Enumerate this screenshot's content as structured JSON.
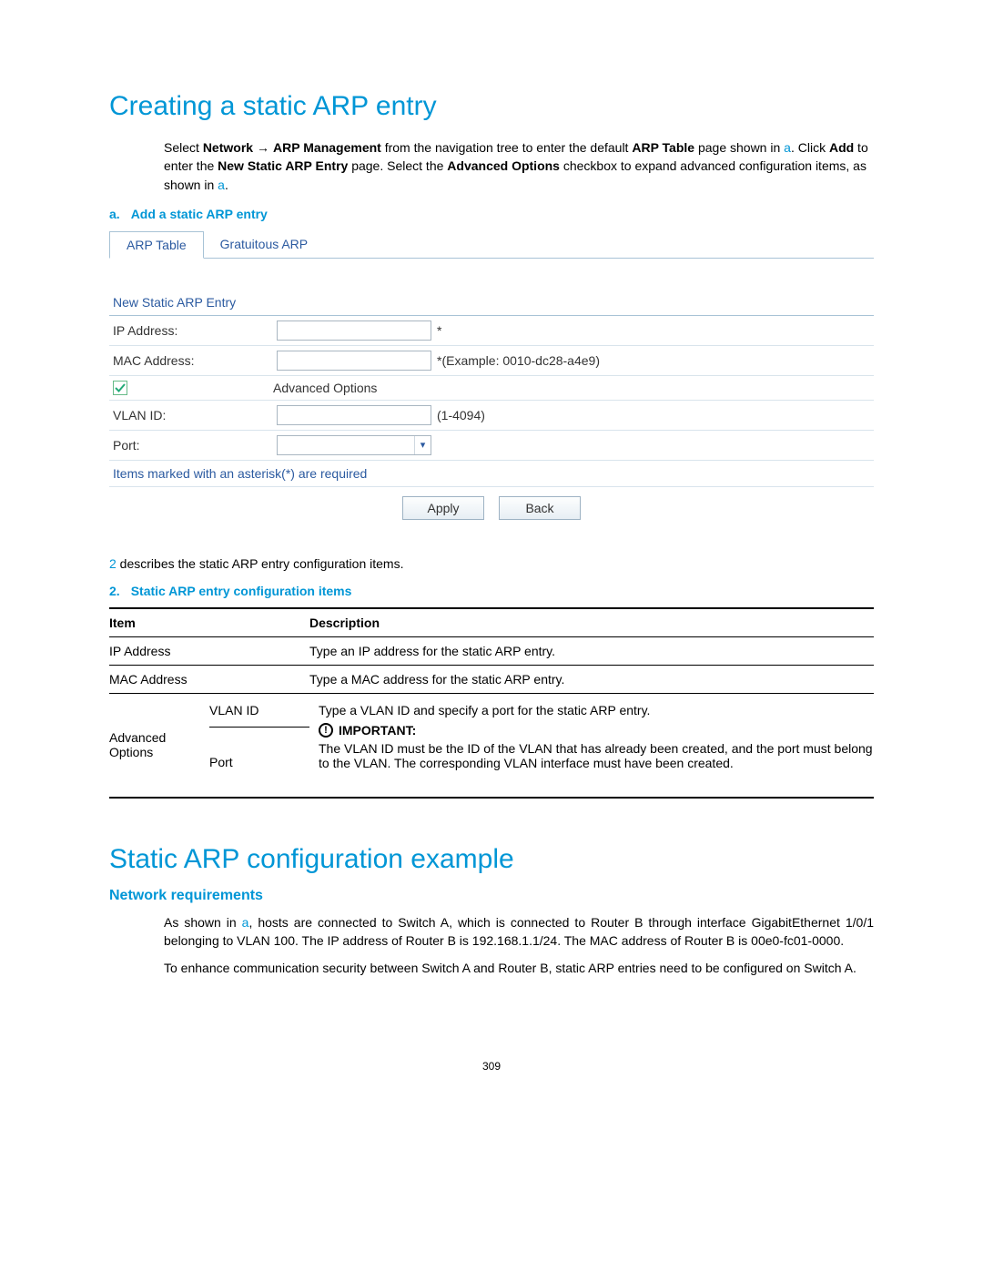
{
  "page_number": "309",
  "section1": {
    "title": "Creating a static ARP entry",
    "para1_pre": "Select ",
    "para1_bold1": "Network",
    "para1_arrow": "→",
    "para1_bold2": "ARP Management",
    "para1_mid1": " from the navigation tree to enter the default ",
    "para1_bold3": "ARP Table",
    "para1_mid2": " page shown in ",
    "para1_linkA": "a",
    "para1_mid3": ". Click ",
    "para1_bold4": "Add",
    "para1_mid4": " to enter the ",
    "para1_bold5": "New Static ARP Entry",
    "para1_mid5": " page. Select the ",
    "para1_bold6": "Advanced Options",
    "para1_mid6": " checkbox to expand advanced configuration items, as shown in ",
    "para1_linkB": "a",
    "para1_end": "."
  },
  "captionA": {
    "label": "a.",
    "text": "Add a static ARP entry"
  },
  "form": {
    "tab_active": "ARP Table",
    "tab_other": "Gratuitous ARP",
    "heading": "New Static ARP Entry",
    "rows": {
      "ip_label": "IP Address:",
      "ip_hint": "*",
      "mac_label": "MAC Address:",
      "mac_hint": "*(Example: 0010-dc28-a4e9)",
      "adv_label": "Advanced Options",
      "vlan_label": "VLAN ID:",
      "vlan_hint": "(1-4094)",
      "port_label": "Port:"
    },
    "note": "Items marked with an asterisk(*) are required",
    "apply": "Apply",
    "back": "Back"
  },
  "mid_para": {
    "link2": "2",
    "rest": " describes the static ARP entry configuration items."
  },
  "caption2": {
    "label": "2.",
    "text": "Static ARP entry configuration items"
  },
  "table": {
    "head_item": "Item",
    "head_desc": "Description",
    "r1_item": "IP Address",
    "r1_desc": "Type an IP address for the static ARP entry.",
    "r2_item": "MAC Address",
    "r2_desc": "Type a MAC address for the static ARP entry.",
    "r3_left": "Advanced Options",
    "r3_vlan": "VLAN ID",
    "r3_port": "Port",
    "r3_top": "Type a VLAN ID and specify a port for the static ARP entry.",
    "r3_imp": "IMPORTANT:",
    "r3_bot": "The VLAN ID must be the ID of the VLAN that has already been created, and the port must belong to the VLAN. The corresponding VLAN interface must have been created."
  },
  "section2": {
    "title": "Static ARP configuration example",
    "sub": "Network requirements",
    "para1_pre": "As shown in ",
    "para1_link": "a",
    "para1_rest": ", hosts are connected to Switch A, which is connected to Router B through interface GigabitEthernet 1/0/1 belonging to VLAN 100. The IP address of Router B is 192.168.1.1/24. The MAC address of Router B is 00e0-fc01-0000.",
    "para2": "To enhance communication security between Switch A and Router B, static ARP entries need to be configured on Switch A."
  }
}
